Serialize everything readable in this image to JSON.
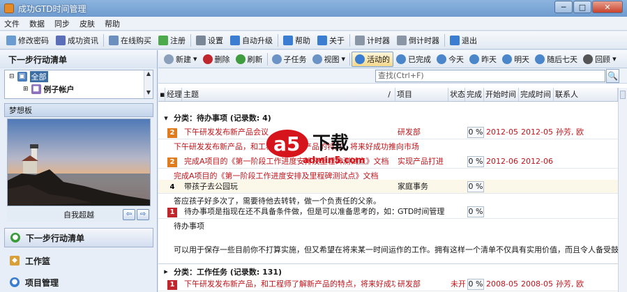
{
  "window": {
    "title": "成功GTD时间管理",
    "min": "─",
    "max": "□",
    "close": "✕"
  },
  "menu": [
    "文件",
    "数据",
    "同步",
    "皮肤",
    "帮助"
  ],
  "toolbar": [
    {
      "label": "修改密码",
      "icon": "edit-icon",
      "color": "#6a9bd1"
    },
    {
      "label": "成功资讯",
      "icon": "book-icon",
      "color": "#5a6fb8"
    },
    {
      "label": "在线购买",
      "icon": "cart-icon",
      "color": "#6d8fbd"
    },
    {
      "label": "注册",
      "icon": "register-icon",
      "color": "#4caa4c"
    },
    {
      "label": "设置",
      "icon": "gear-icon",
      "color": "#7a8796"
    },
    {
      "label": "自动升级",
      "icon": "upgrade-icon",
      "color": "#3b7dd1"
    },
    {
      "label": "帮助",
      "icon": "help-icon",
      "color": "#3b7dd1"
    },
    {
      "label": "关于",
      "icon": "info-icon",
      "color": "#3b7dd1"
    },
    {
      "label": "计时器",
      "icon": "timer-icon",
      "color": "#8a96a6"
    },
    {
      "label": "倒计时器",
      "icon": "countdown-icon",
      "color": "#8a96a6"
    },
    {
      "label": "退出",
      "icon": "exit-icon",
      "color": "#3b7dd1"
    }
  ],
  "left": {
    "header": "下一步行动清单",
    "tree": {
      "root": "全部",
      "child": "例子帐户",
      "scroll_up": "▲",
      "scroll_down": "▼"
    },
    "dream_header": "梦想板",
    "dream_caption": "自我超越",
    "prev": "⇦",
    "next": "⇨",
    "nav": [
      {
        "label": "下一步行动清单",
        "icon": "next-action-icon",
        "color": "#3a9b3a"
      },
      {
        "label": "工作篮",
        "icon": "basket-icon",
        "color": "#d9a03a"
      },
      {
        "label": "项目管理",
        "icon": "project-icon",
        "color": "#3b7dd1"
      }
    ]
  },
  "toolbar2": [
    {
      "label": "新建",
      "icon": "new-icon",
      "color": "#8aa0bb",
      "dropdown": "▾"
    },
    {
      "label": "删除",
      "icon": "delete-icon",
      "color": "#c0272d"
    },
    {
      "label": "刷新",
      "icon": "refresh-icon",
      "color": "#3f9c3f"
    },
    {
      "label": "子任务",
      "icon": "subtask-icon",
      "color": "#6b93c6"
    },
    {
      "label": "视图",
      "icon": "view-icon",
      "color": "#6b93c6",
      "dropdown": "▾"
    },
    {
      "label": "活动的",
      "icon": "active-icon",
      "color": "#3b7dd1",
      "active": true
    },
    {
      "label": "已完成",
      "icon": "done-icon",
      "color": "#4a86c9"
    },
    {
      "label": "今天",
      "icon": "today-icon",
      "color": "#4a86c9"
    },
    {
      "label": "昨天",
      "icon": "yesterday-icon",
      "color": "#4a86c9"
    },
    {
      "label": "明天",
      "icon": "tomorrow-icon",
      "color": "#4a86c9"
    },
    {
      "label": "随后七天",
      "icon": "week-icon",
      "color": "#4a86c9"
    },
    {
      "label": "回顾",
      "icon": "review-icon",
      "color": "#555555",
      "dropdown": "▾"
    }
  ],
  "search": {
    "placeholder": "查找(Ctrl+F)",
    "icon": "🔍"
  },
  "columns": [
    "经理",
    "主题",
    "/",
    "项目",
    "状态",
    "完成",
    "开始时间",
    "完成时间",
    "联系人"
  ],
  "groups": [
    {
      "label": "分类：待办事项 (记录数: 4)",
      "toggle": "▾"
    },
    {
      "label": "分类：工作任务 (记录数: 131)",
      "toggle": "▸"
    }
  ],
  "rows": [
    {
      "prio": "2",
      "prio_color": "#e07b1e",
      "subject": "下午研发发布新产品会议",
      "project": "研发部",
      "status": "",
      "pct": "0 %",
      "start": "2012-05-",
      "end": "2012-05-",
      "contact": "孙芳, 欧",
      "red": true,
      "note": "下午研发发布新产品，和工程师了解新产品的特点，将来好成功推向市场"
    },
    {
      "prio": "2",
      "prio_color": "#e07b1e",
      "subject": "完成A项目的《第一阶段工作进度安排及里程碑测试点》文档",
      "project": "实现产品打进",
      "status": "",
      "pct": "0 %",
      "start": "2012-06-",
      "end": "2012-06-",
      "contact": "",
      "red": true,
      "note": "完成A项目的《第一阶段工作进度安排及里程碑测试点》文档"
    },
    {
      "prio": "4",
      "prio_color": "#ffffff",
      "subject": "带孩子去公园玩",
      "project": "家庭事务",
      "status": "",
      "pct": "0 %",
      "start": "",
      "end": "",
      "contact": "",
      "red": false,
      "note": "答应孩子好多次了，需要待他去转转，做一个负责任的父亲。"
    },
    {
      "prio": "1",
      "prio_color": "#c0272d",
      "subject": "待办事项是指现在还不具备条件做，但是可以准备思考的，如：想要读的",
      "project": "GTD时间管理",
      "status": "",
      "pct": "0 %",
      "start": "",
      "end": "",
      "contact": "",
      "red": false,
      "note": "待办事项",
      "note2": "可以用于保存一些目前你不打算实施，但又希望在将来某一时间运作的工作。拥有这样一个清单不仅具有实用价值，而且令人备受鼓"
    },
    {
      "prio": "1",
      "prio_color": "#c0272d",
      "subject": "下午研发发布新产品，和工程师了解新产品的特点，将来好成功推向市",
      "project": "研发部",
      "status": "未开",
      "pct": "0 %",
      "start": "2008-05-",
      "end": "2008-05-",
      "contact": "孙芳, 欧",
      "red": true
    }
  ],
  "watermark": {
    "brand": "a5",
    "tag": "下载",
    "url": "admin5.com"
  }
}
